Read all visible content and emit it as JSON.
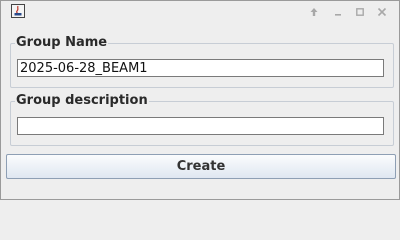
{
  "window": {
    "controls": {
      "up_icon": "arrow-up-icon",
      "minimize_icon": "minimize-icon",
      "maximize_icon": "maximize-icon",
      "close_icon": "close-icon"
    }
  },
  "form": {
    "group_name": {
      "label": "Group Name",
      "value": "2025-06-28_BEAM1"
    },
    "group_description": {
      "label": "Group description",
      "value": ""
    },
    "create_label": "Create"
  },
  "colors": {
    "window_bg": "#eeeeee",
    "border": "#c7cdd5",
    "button_border": "#8e9fb4"
  }
}
